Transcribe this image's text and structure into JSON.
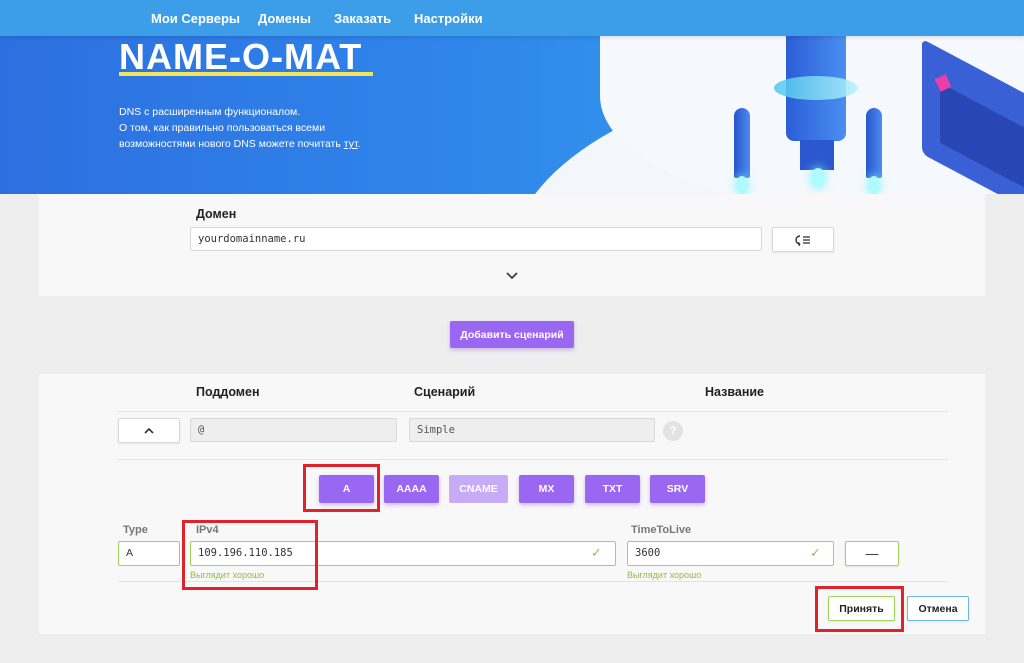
{
  "nav": {
    "items": [
      "Мои Серверы",
      "Домены",
      "Заказать",
      "Настройки"
    ]
  },
  "hero": {
    "logo": "NAME-O-MAT",
    "desc_line1": "DNS с расширенным функционалом.",
    "desc_line2": "О том, как правильно пользоваться всеми",
    "desc_line3_prefix": "возможностями нового DNS можете почитать ",
    "desc_link": "тут",
    "desc_line3_suffix": "."
  },
  "domain_panel": {
    "label": "Домен",
    "input_value": "yourdomainname.ru",
    "search_icon": "list-search-icon",
    "expand_icon": "chevron-down-icon"
  },
  "add_scenario_button": "Добавить сценарий",
  "records": {
    "columns": [
      "Поддомен",
      "Сценарий",
      "Название"
    ],
    "row": {
      "subdomain": "@",
      "scenario": "Simple",
      "help": "?",
      "collapse_icon": "chevron-up-icon"
    },
    "types": [
      {
        "label": "A",
        "state": "active"
      },
      {
        "label": "AAAA",
        "state": "normal"
      },
      {
        "label": "CNAME",
        "state": "disabled"
      },
      {
        "label": "MX",
        "state": "normal"
      },
      {
        "label": "TXT",
        "state": "normal"
      },
      {
        "label": "SRV",
        "state": "normal"
      }
    ],
    "fields": {
      "type_label": "Type",
      "type_value": "A",
      "ipv4_label": "IPv4",
      "ipv4_value": "109.196.110.185",
      "ipv4_hint": "Выглядит хорошо",
      "ttl_label": "TimeToLive",
      "ttl_value": "3600",
      "ttl_hint": "Выглядит хорошо",
      "remove": "—"
    },
    "accept_button": "Принять",
    "cancel_button": "Отмена"
  },
  "colors": {
    "nav": "#3c9ee8",
    "accent_purple": "#9a67f2",
    "valid_green": "#8cc34a",
    "highlight_red": "#e0222a"
  }
}
